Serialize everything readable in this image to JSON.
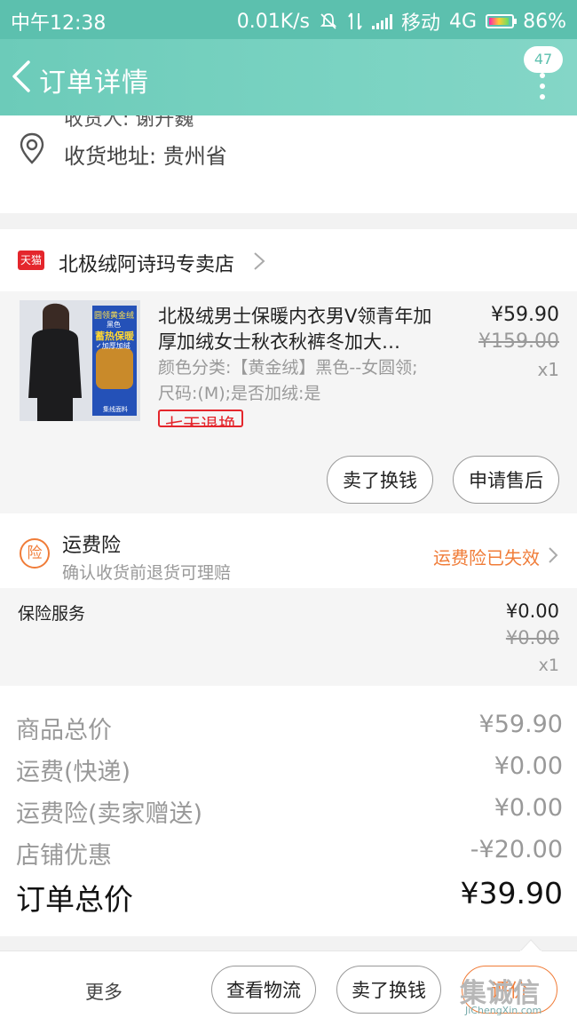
{
  "status_bar": {
    "time": "中午12:38",
    "speed": "0.01K/s",
    "carrier": "移动",
    "network": "4G",
    "battery": "86%"
  },
  "nav": {
    "title": "订单详情",
    "badge": "47",
    "back_icon": "chevron-left-icon",
    "more_icon": "more-vertical-icon"
  },
  "address": {
    "consignee": "收货人: 谢升巍",
    "address": "收货地址: 贵州省",
    "pin_icon": "location-pin-icon"
  },
  "shop": {
    "badge": "天猫",
    "name": "北极绒阿诗玛专卖店"
  },
  "item": {
    "title": "北极绒男士保暖内衣男V领青年加厚加绒女士秋衣秋裤冬加大…",
    "sku": "颜色分类:【黄金绒】黑色--女圆领;尺码:(M);是否加绒:是",
    "tag": "七天退换",
    "price": "¥59.90",
    "original_price": "¥159.00",
    "quantity": "x1",
    "thumb_texts": [
      "圆领黄金绒",
      "黑色",
      "蓄热保暖",
      "✓加厚加绒",
      "集线面料"
    ],
    "buttons": [
      "卖了换钱",
      "申请售后"
    ]
  },
  "insurance": {
    "icon_text": "险",
    "title": "运费险",
    "subtitle": "确认收货前退货可理赔",
    "status": "运费险已失效"
  },
  "service": {
    "label": "保险服务",
    "price": "¥0.00",
    "original_price": "¥0.00",
    "quantity": "x1"
  },
  "summary": {
    "rows": [
      {
        "label": "商品总价",
        "value": "¥59.90"
      },
      {
        "label": "运费(快递)",
        "value": "¥0.00"
      },
      {
        "label": "运费险(卖家赠送)",
        "value": "¥0.00"
      },
      {
        "label": "店铺优惠",
        "value": "-¥20.00"
      }
    ],
    "total_label": "订单总价",
    "total_value": "¥39.90"
  },
  "bottom_bar": {
    "more": "更多",
    "buttons": [
      "查看物流",
      "卖了换钱",
      "评价"
    ]
  },
  "watermark": {
    "logo": "集诚信",
    "url": "JiChengXin.com"
  },
  "colors": {
    "accent": "#5cc0ae",
    "orange": "#f07c38",
    "tmall_red": "#e4262c"
  }
}
